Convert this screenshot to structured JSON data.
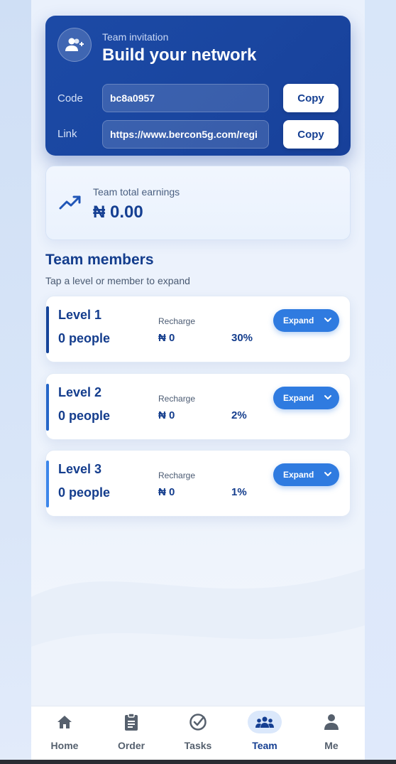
{
  "invite": {
    "kicker": "Team invitation",
    "title": "Build your network",
    "code_label": "Code",
    "code_value": "bc8a0957",
    "link_label": "Link",
    "link_value": "https://www.bercon5g.com/regi",
    "copy_label": "Copy",
    "icon": "add-user-icon"
  },
  "earnings": {
    "label": "Team total earnings",
    "value": "₦ 0.00",
    "icon": "trending-up-icon"
  },
  "team": {
    "title": "Team members",
    "subtitle": "Tap a level or member to expand"
  },
  "levels": [
    {
      "name": "Level 1",
      "people": "0 people",
      "recharge_label": "Recharge",
      "recharge": "₦ 0",
      "percent": "30%",
      "expand_label": "Expand",
      "accent": "#15449a"
    },
    {
      "name": "Level 2",
      "people": "0 people",
      "recharge_label": "Recharge",
      "recharge": "₦ 0",
      "percent": "2%",
      "expand_label": "Expand",
      "accent": "#2566c8"
    },
    {
      "name": "Level 3",
      "people": "0 people",
      "recharge_label": "Recharge",
      "recharge": "₦ 0",
      "percent": "1%",
      "expand_label": "Expand",
      "accent": "#3c86ea"
    }
  ],
  "nav": [
    {
      "label": "Home",
      "icon": "home-icon",
      "active": false
    },
    {
      "label": "Order",
      "icon": "clipboard-icon",
      "active": false
    },
    {
      "label": "Tasks",
      "icon": "check-circle-icon",
      "active": false
    },
    {
      "label": "Team",
      "icon": "group-icon",
      "active": true
    },
    {
      "label": "Me",
      "icon": "person-icon",
      "active": false
    }
  ],
  "colors": {
    "primary": "#1a46a0",
    "accent": "#2f7be0",
    "text_dark": "#143d8d"
  }
}
